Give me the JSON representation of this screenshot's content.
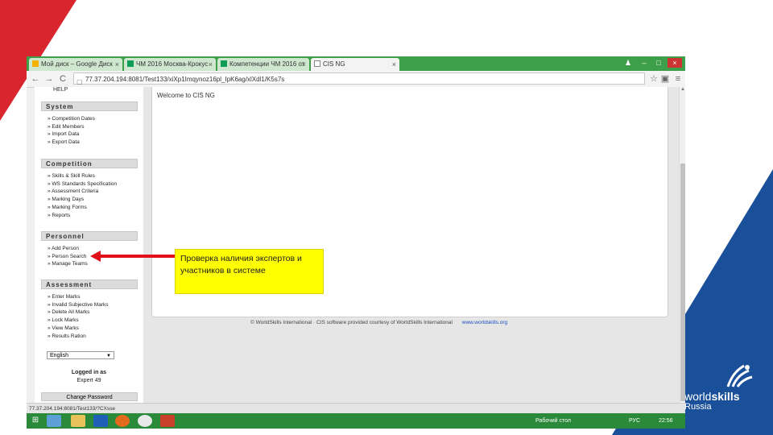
{
  "browser": {
    "tabs": [
      {
        "label": "Мой диск – Google Диск",
        "close": "×"
      },
      {
        "label": "ЧМ 2016 Москва-Крокус",
        "close": "×"
      },
      {
        "label": "Компетенции ЧМ 2016 от",
        "close": "×"
      },
      {
        "label": "CIS NG",
        "close": "×",
        "active": true
      }
    ],
    "window_controls": {
      "minimize": "–",
      "maximize": "□",
      "close": "×"
    },
    "user_icon": "♟",
    "back": "←",
    "forward": "→",
    "reload": "C",
    "url": "77.37.204.194:8081/Test133/xiXp1Imqynoz16pl_IpK6ag/xlXdl1/K5s7s",
    "star": "☆",
    "extension": "▣",
    "menu": "≡"
  },
  "sidebar": {
    "help": "HELP",
    "sections": [
      {
        "title": "System",
        "items": [
          "Competition Dates",
          "Edit Members",
          "Import Data",
          "Export Data"
        ]
      },
      {
        "title": "Competition",
        "items": [
          "Skills & Skill Rules",
          "WS Standards Specification",
          "Assessment Criteria",
          "Marking Days",
          "Marking Forms",
          "Reports"
        ]
      },
      {
        "title": "Personnel",
        "items": [
          "Add Person",
          "Person Search",
          "Manage Teams"
        ]
      },
      {
        "title": "Assessment",
        "items": [
          "Enter Marks",
          "Invalid Subjective Marks",
          "Delete All Marks",
          "Lock Marks",
          "View Marks",
          "Results Ration"
        ]
      }
    ],
    "language": "English",
    "language_arrow": "▼",
    "logged_in_label": "Logged in as",
    "logged_in_user": "Expert 49",
    "change_password": "Change Password"
  },
  "content": {
    "welcome": "Welcome to CIS NG",
    "footer_text": "© WorldSkills International · CIS software provided courtesy of WorldSkills International",
    "footer_link": "www.worldskills.org"
  },
  "scrollbar": {
    "up_arrow": "▲"
  },
  "status_url": "77.37.204.194:8081/Test133/?CXsse",
  "taskbar": {
    "start": "⊞",
    "desktop_label": "Рабочий стол",
    "language": "РУС",
    "time": "22:56"
  },
  "callout": {
    "text": "Проверка наличия экспертов и участников в системе"
  },
  "logo": {
    "line1": "world",
    "line2": "skills",
    "line3": "Russia"
  },
  "colors": {
    "red_corner": "#d9262e",
    "blue_corner": "#1a4f9a",
    "tab_bar": "#3e9f4a",
    "callout": "#ffff00",
    "arrow": "#e0101a"
  }
}
